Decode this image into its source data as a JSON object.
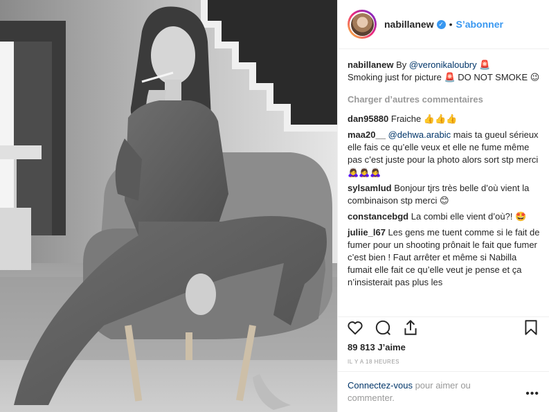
{
  "post": {
    "author": "nabillanew",
    "follow_label": "S’abonner",
    "separator": "•"
  },
  "caption": {
    "user": "nabillanew",
    "prefix": "By ",
    "mention": "@veronikaloubry",
    "text_1": " 🚨",
    "text_2": "Smoking just for picture 🚨 DO NOT SMOKE 😉"
  },
  "load_more_label": "Charger d’autres commentaires",
  "comments": [
    {
      "user": "dan95880",
      "mention": "",
      "text": "Fraiche 👍👍👍"
    },
    {
      "user": "maa20__",
      "mention": "@dehwa.arabic",
      "text": " mais ta gueul sérieux elle fais ce qu’elle veux et elle ne fume même pas c’est juste pour la photo alors sort stp merci 🙇‍♀️🙇‍♀️🙇‍♀️"
    },
    {
      "user": "sylsamlud",
      "mention": "",
      "text": "Bonjour tjrs très belle d’où vient la combinaison stp merci 😊"
    },
    {
      "user": "constancebgd",
      "mention": "",
      "text": "La combi elle vient d’où?! 🤩"
    },
    {
      "user": "juliie_l67",
      "mention": "",
      "text": "Les gens me tuent comme si le fait de fumer pour un shooting prônait le fait que fumer c’est bien ! Faut arrêter et même si Nabilla fumait elle fait ce qu’elle veut je pense et ça n’insisterait pas plus les"
    }
  ],
  "likes_label": "89 813 J’aime",
  "timestamp": "IL Y A 18 HEURES",
  "login_prompt": {
    "link": "Connectez-vous",
    "text": " pour aimer ou commenter."
  },
  "more_options": "•••",
  "icons": {
    "like": "heart-icon",
    "comment": "comment-bubble-icon",
    "share": "share-icon",
    "save": "bookmark-icon",
    "verified": "verified-badge-icon"
  },
  "colors": {
    "accent": "#3897f0",
    "muted": "#999999",
    "link": "#003569"
  }
}
